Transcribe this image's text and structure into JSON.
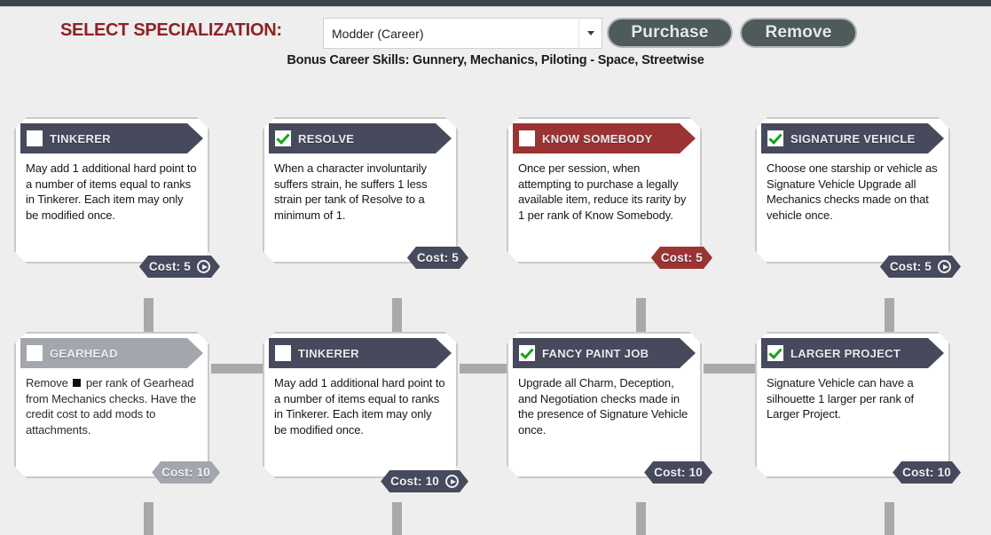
{
  "header": {
    "select_label": "SELECT SPECIALIZATION:",
    "specialization_value": "Modder (Career)",
    "purchase_label": "Purchase",
    "remove_label": "Remove",
    "bonus_skills": "Bonus Career Skills: Gunnery, Mechanics, Piloting - Space, Streetwise",
    "dropdown_icon": "chevron-down-icon",
    "accent_color": "#8e2226",
    "button_color": "#4e5a5c"
  },
  "colors": {
    "background": "#eeeeee",
    "card_dark": "#474a5c",
    "card_red": "#9b3333",
    "card_disabled": "#a4a6ae",
    "connector": "#a9a9a9",
    "check_green": "#19a319"
  },
  "talents": [
    {
      "title": "TINKERER",
      "description": "May add 1 additional hard point to a number of items equal to ranks in Tinkerer. Each item may only be modified once.",
      "cost_label": "Cost: 5",
      "checked": false,
      "style": "dark",
      "has_play_icon": true,
      "row": 1,
      "col": 1
    },
    {
      "title": "RESOLVE",
      "description": "When a character involuntarily suffers strain, he suffers 1 less strain per tank of Resolve to a minimum of 1.",
      "cost_label": "Cost: 5",
      "checked": true,
      "style": "dark",
      "has_play_icon": false,
      "row": 1,
      "col": 2
    },
    {
      "title": "KNOW SOMEBODY",
      "description": "Once per session, when attempting to purchase a legally available item, reduce its rarity by 1 per rank of Know Somebody.",
      "cost_label": "Cost: 5",
      "checked": false,
      "style": "red",
      "has_play_icon": false,
      "row": 1,
      "col": 3
    },
    {
      "title": "SIGNATURE VEHICLE",
      "description": "Choose one starship or vehicle as Signature Vehicle Upgrade all Mechanics checks made on that vehicle once.",
      "cost_label": "Cost: 5",
      "checked": true,
      "style": "dark",
      "has_play_icon": true,
      "row": 1,
      "col": 4
    },
    {
      "title": "GEARHEAD",
      "description_pre": "Remove ",
      "description_post": " per rank of Gearhead from Mechanics checks. Have the credit cost to add mods to attachments.",
      "description": "Remove ■ per rank of Gearhead from Mechanics checks. Have the credit cost to add mods to attachments.",
      "cost_label": "Cost: 10",
      "checked": false,
      "style": "disabled",
      "has_play_icon": false,
      "row": 2,
      "col": 1
    },
    {
      "title": "TINKERER",
      "description": "May add 1 additional hard point to a number of items equal to ranks in Tinkerer. Each item may only be modified once.",
      "cost_label": "Cost: 10",
      "checked": false,
      "style": "dark",
      "has_play_icon": true,
      "row": 2,
      "col": 2
    },
    {
      "title": "FANCY PAINT JOB",
      "description": "Upgrade all Charm, Deception, and Negotiation checks made in the presence of Signature Vehicle once.",
      "cost_label": "Cost: 10",
      "checked": true,
      "style": "dark",
      "has_play_icon": false,
      "row": 2,
      "col": 3
    },
    {
      "title": "LARGER PROJECT",
      "description": "Signature Vehicle can have a silhouette 1 larger per rank of Larger Project.",
      "cost_label": "Cost: 10",
      "checked": true,
      "style": "dark",
      "has_play_icon": false,
      "row": 2,
      "col": 4
    }
  ]
}
